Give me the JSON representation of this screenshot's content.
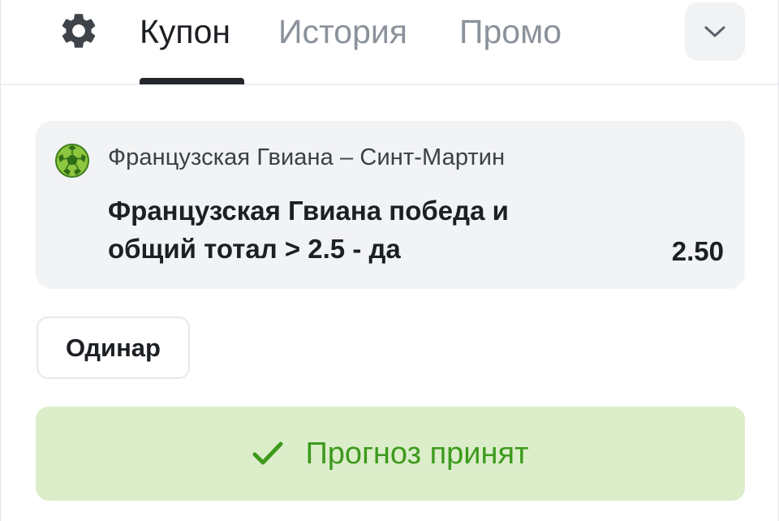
{
  "header": {
    "settings_icon": "gear-icon",
    "tabs": [
      {
        "label": "Купон",
        "active": true
      },
      {
        "label": "История",
        "active": false
      },
      {
        "label": "Промо",
        "active": false
      }
    ],
    "expand_icon": "chevron-down-icon"
  },
  "coupon": {
    "sport_icon": "football-icon",
    "match": "Французская Гвиана – Синт-Мартин",
    "bet_line1": "Французская Гвиана победа и",
    "bet_line2": "общий тотал > 2.5 - да",
    "odds": "2.50"
  },
  "bet_type": {
    "label": "Одинар"
  },
  "status": {
    "icon": "check-icon",
    "label": "Прогноз принят"
  },
  "colors": {
    "accent_green": "#3c9a1c",
    "banner_bg": "#dcedca",
    "card_bg": "#f2f3f5",
    "tab_active": "#1c1f23",
    "tab_inactive": "#8b929b"
  }
}
